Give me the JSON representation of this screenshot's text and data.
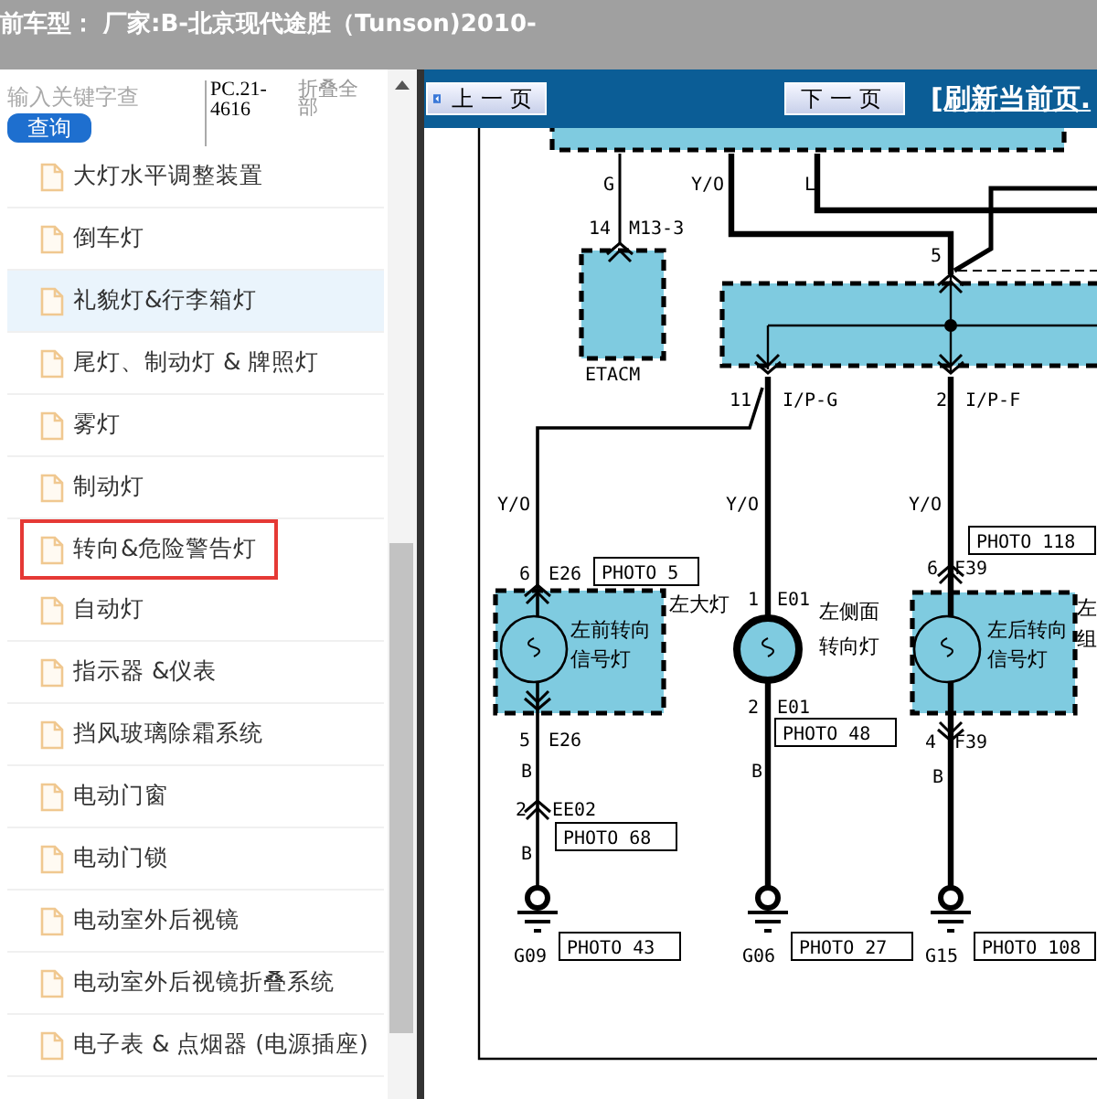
{
  "header": {
    "title": "前车型： 厂家:B-北京现代途胜（Tunson)2010-"
  },
  "sidebar": {
    "search": {
      "placeholder": "输入关键字查"
    },
    "search_button": "查询",
    "code": "PC.21-4616",
    "collapse_all": "折叠全部",
    "items": [
      {
        "label": "大灯水平调整装置",
        "selected": false,
        "highlighted": false
      },
      {
        "label": "倒车灯",
        "selected": false,
        "highlighted": false
      },
      {
        "label": "礼貌灯&行李箱灯",
        "selected": false,
        "highlighted": true
      },
      {
        "label": "尾灯、制动灯 & 牌照灯",
        "selected": false,
        "highlighted": false
      },
      {
        "label": "雾灯",
        "selected": false,
        "highlighted": false
      },
      {
        "label": "制动灯",
        "selected": false,
        "highlighted": false
      },
      {
        "label": "转向&危险警告灯",
        "selected": true,
        "highlighted": false
      },
      {
        "label": "自动灯",
        "selected": false,
        "highlighted": false
      },
      {
        "label": "指示器 &仪表",
        "selected": false,
        "highlighted": false
      },
      {
        "label": "挡风玻璃除霜系统",
        "selected": false,
        "highlighted": false
      },
      {
        "label": "电动门窗",
        "selected": false,
        "highlighted": false
      },
      {
        "label": "电动门锁",
        "selected": false,
        "highlighted": false
      },
      {
        "label": "电动室外后视镜",
        "selected": false,
        "highlighted": false
      },
      {
        "label": "电动室外后视镜折叠系统",
        "selected": false,
        "highlighted": false
      },
      {
        "label": "电子表 & 点烟器 (电源插座)",
        "selected": false,
        "highlighted": false
      }
    ]
  },
  "toolbar": {
    "prev_button": "上一页",
    "next_button": "下一页",
    "refresh_link": "[刷新当前页."
  },
  "diagram": {
    "wire_labels": [
      "G",
      "Y/O",
      "L",
      "Y/O",
      "Y/O",
      "Y/O",
      "B",
      "B",
      "B",
      "B"
    ],
    "pins": [
      "14",
      "M13-3",
      "5",
      "11",
      "I/P-G",
      "2",
      "I/P-F",
      "6",
      "E26",
      "5",
      "E26",
      "1",
      "E01",
      "2",
      "E01",
      "6",
      "F39",
      "4",
      "F39",
      "2",
      "EE02"
    ],
    "components": [
      {
        "lines": [
          "ETACM"
        ]
      },
      {
        "lines": [
          "左大灯"
        ]
      },
      {
        "lines": [
          "左前转向",
          "信号灯"
        ]
      },
      {
        "lines": [
          "左侧面",
          "转向灯"
        ]
      },
      {
        "lines": [
          "左后转向",
          "信号灯"
        ]
      },
      {
        "lines": [
          "左",
          "组"
        ]
      }
    ],
    "photo_refs": [
      "PHOTO 5",
      "PHOTO 48",
      "PHOTO 118",
      "PHOTO 68",
      "PHOTO 43",
      "PHOTO 27",
      "PHOTO 108"
    ],
    "grounds": [
      "G09",
      "G06",
      "G15"
    ]
  }
}
